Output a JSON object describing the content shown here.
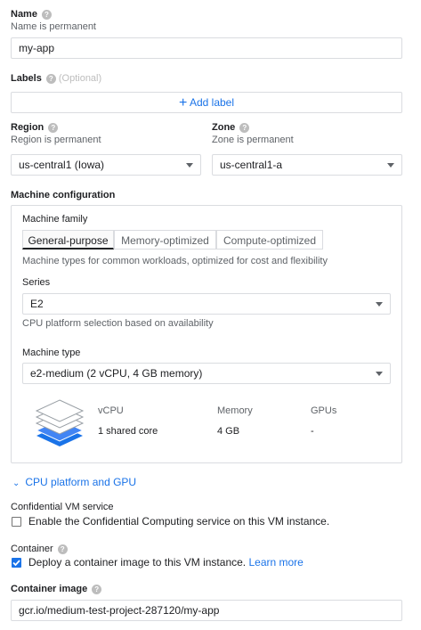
{
  "name": {
    "label": "Name",
    "hint": "Name is permanent",
    "value": "my-app"
  },
  "labels": {
    "label": "Labels",
    "optional": "(Optional)",
    "add_label": "Add label"
  },
  "region": {
    "label": "Region",
    "hint": "Region is permanent",
    "value": "us-central1 (Iowa)"
  },
  "zone": {
    "label": "Zone",
    "hint": "Zone is permanent",
    "value": "us-central1-a"
  },
  "machine_config": {
    "label": "Machine configuration",
    "family_label": "Machine family",
    "tabs": [
      "General-purpose",
      "Memory-optimized",
      "Compute-optimized"
    ],
    "active_tab": "General-purpose",
    "family_desc": "Machine types for common workloads, optimized for cost and flexibility",
    "series_label": "Series",
    "series_value": "E2",
    "series_desc": "CPU platform selection based on availability",
    "type_label": "Machine type",
    "type_value": "e2-medium (2 vCPU, 4 GB memory)",
    "summary": {
      "headers": [
        "vCPU",
        "Memory",
        "GPUs"
      ],
      "values": [
        "1 shared core",
        "4 GB",
        "-"
      ]
    }
  },
  "cpu_gpu_link": "CPU platform and GPU",
  "confidential": {
    "label": "Confidential VM service",
    "checkbox_text": "Enable the Confidential Computing service on this VM instance.",
    "checked": false
  },
  "container": {
    "label": "Container",
    "checkbox_text": "Deploy a container image to this VM instance.",
    "learn_more": "Learn more",
    "checked": true
  },
  "container_image": {
    "label": "Container image",
    "value": "gcr.io/medium-test-project-287120/my-app"
  },
  "colors": {
    "accent": "#1a73e8",
    "text": "#202124",
    "muted": "#5f6368",
    "border": "#dadce0"
  }
}
